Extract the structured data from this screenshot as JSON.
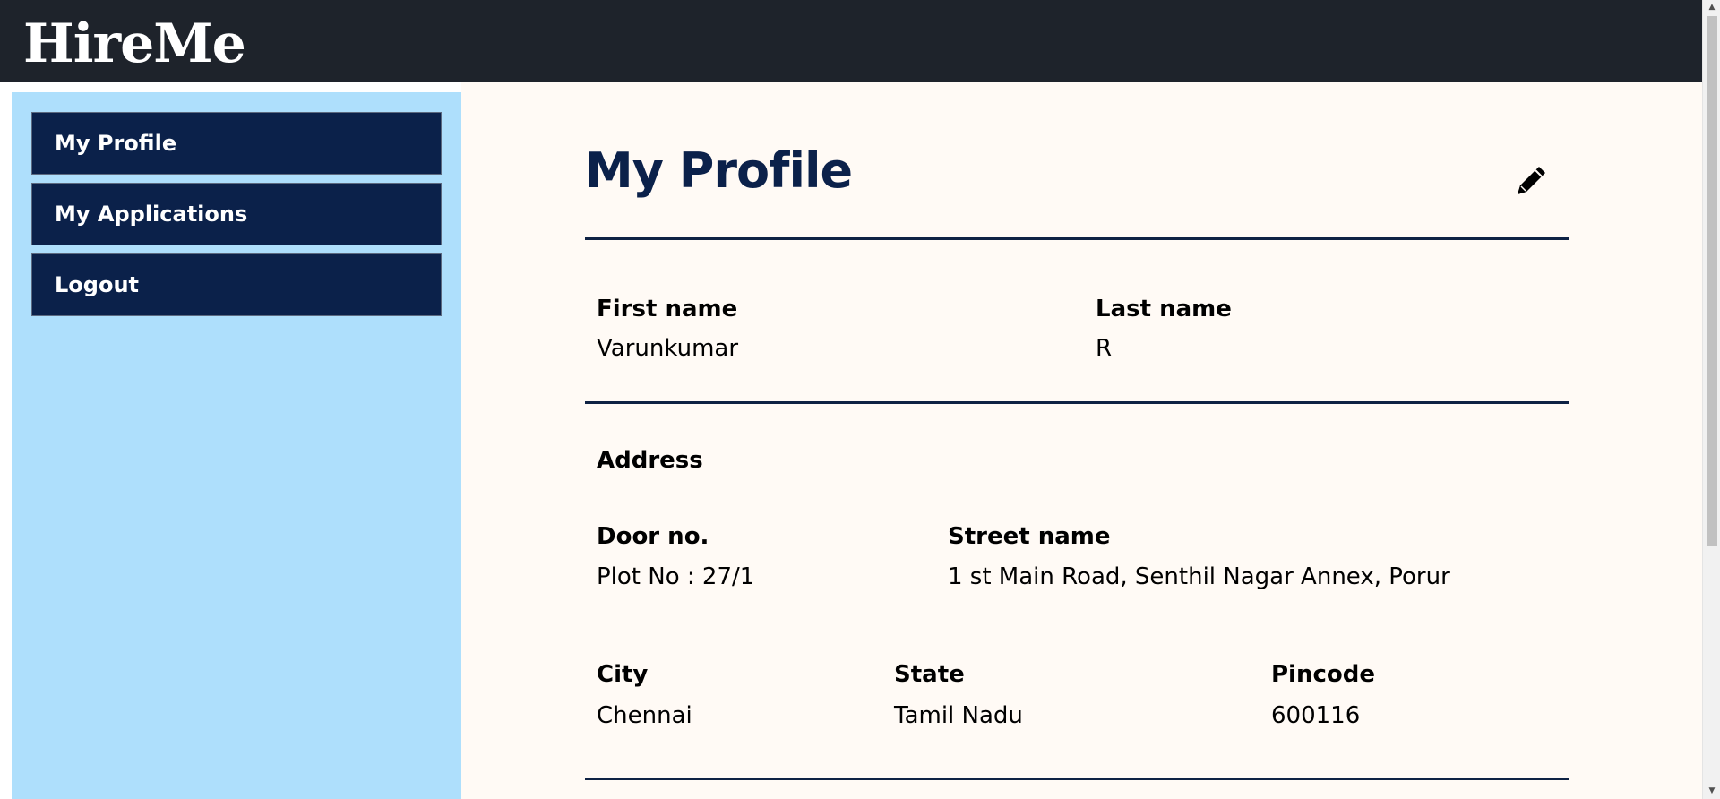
{
  "header": {
    "brand": "HireMe"
  },
  "sidebar": {
    "items": [
      {
        "label": "My Profile"
      },
      {
        "label": "My Applications"
      },
      {
        "label": "Logout"
      }
    ]
  },
  "profile": {
    "title": "My Profile",
    "edit_icon": "pencil-icon",
    "first_name_label": "First name",
    "first_name": "Varunkumar",
    "last_name_label": "Last name",
    "last_name": "R",
    "address_heading": "Address",
    "door_label": "Door no.",
    "door": "Plot No : 27/1",
    "street_label": "Street name",
    "street": "1 st Main Road, Senthil Nagar Annex, Porur",
    "city_label": "City",
    "city": "Chennai",
    "state_label": "State",
    "state": "Tamil Nadu",
    "pincode_label": "Pincode",
    "pincode": "600116"
  },
  "colors": {
    "header_bg": "#1e232b",
    "sidebar_bg": "#aedffc",
    "nav_bg": "#0b214a",
    "main_bg": "#fffaf5",
    "title": "#0b214a"
  }
}
